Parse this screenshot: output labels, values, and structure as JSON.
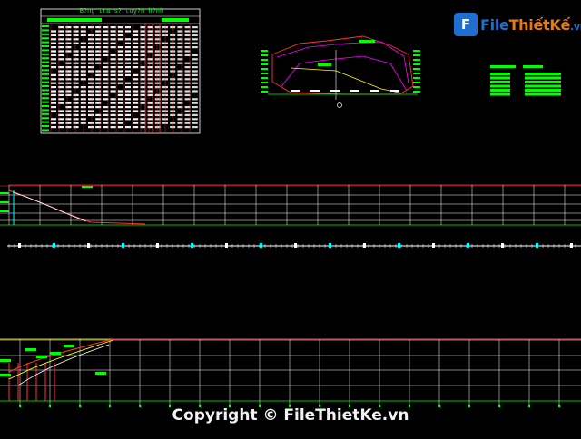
{
  "drawing": {
    "background": "#000000",
    "table_title": "B?ng tra s? tuy?n h?nh",
    "colors": {
      "primary_line": "#ff3333",
      "grid": "#ffffff",
      "green": "#00ff00",
      "yellow": "#ffff00",
      "cyan": "#00ffff",
      "magenta": "#ff00ff"
    }
  },
  "logo": {
    "badge": "F",
    "text_a": "File",
    "text_b": "ThiếtKế",
    "tld": ".vn"
  },
  "watermark": "Copyright © FileThietKe.vn"
}
